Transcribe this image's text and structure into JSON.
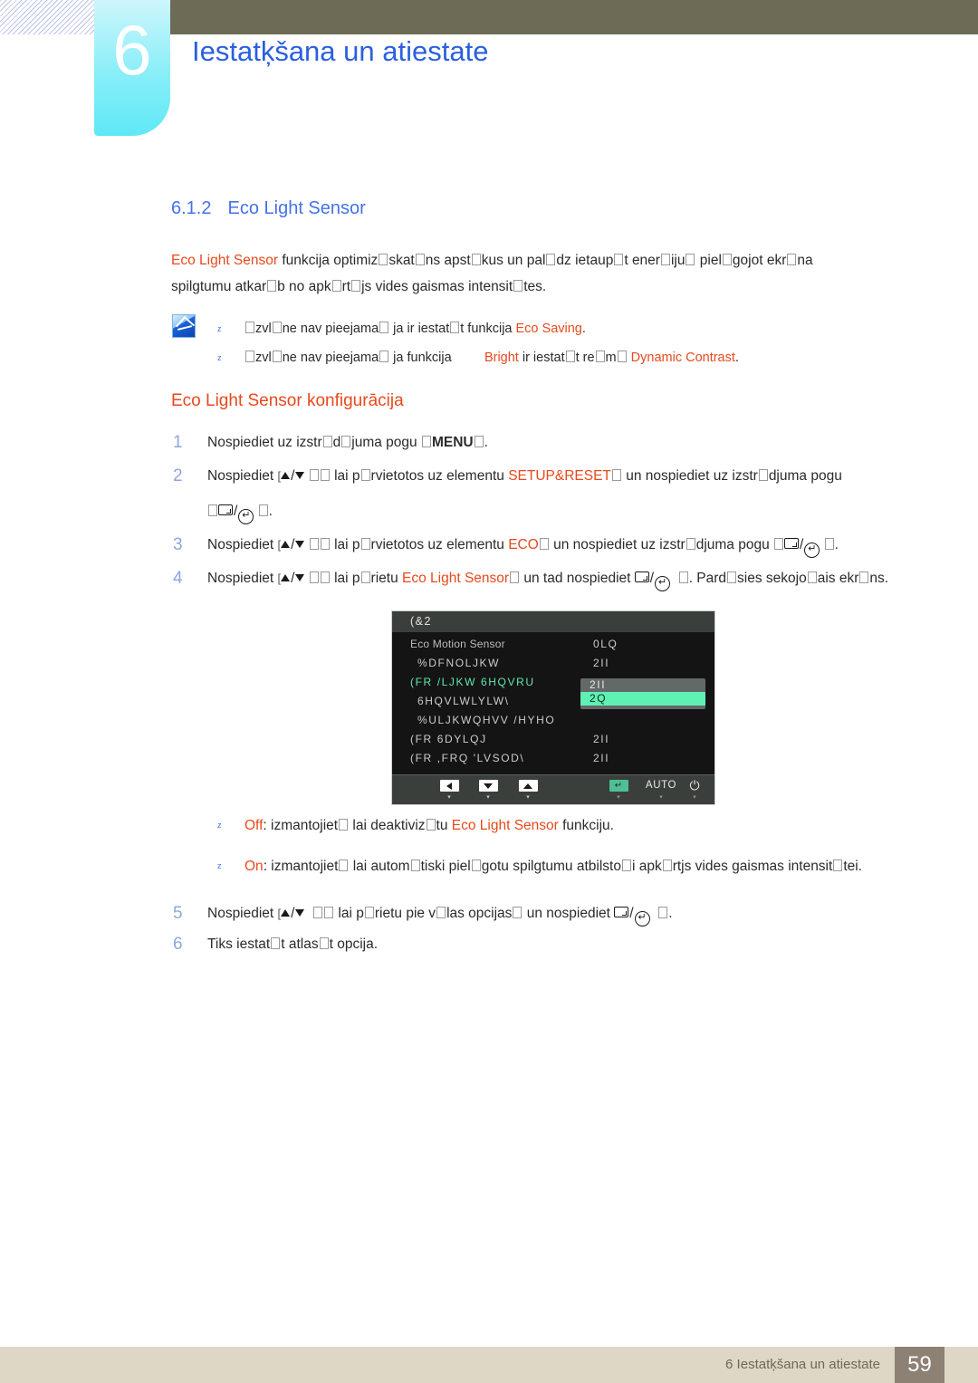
{
  "header": {
    "chapter_number": "6",
    "chapter_title": "Iestatķšana un atiestate"
  },
  "section": {
    "number": "6.1.2",
    "title": "Eco Light Sensor"
  },
  "intro": {
    "term": "Eco Light Sensor",
    "text_part1": " funkcija optimiz",
    "text_part2": "skat",
    "text_part3": "ns apst",
    "text_part4": "k",
    "text_part5": "us un pal",
    "text_part6": "dz ietaup",
    "text_part7": "t ener",
    "text_part8": "iju",
    "text_part9": " piel",
    "text_part10": "gojot ekr",
    "text_part11": "na spilgtumu atkar",
    "text_part12": "b",
    "text_part13": " no apk",
    "text_part14": "rt",
    "text_part15": "js vides gaismas intensit",
    "text_part16": "tes.",
    "full": "Eco Light Sensor funkcija optimiz skatans apstkus un paldz ietaupt eneriju, pielgojot ekrna spilgtumu atkarb no apkrtjs vides gaismas intensittes."
  },
  "note": {
    "icon": "note-pencil-icon",
    "bullets": [
      {
        "marker": "z",
        "pre": "zvl",
        "pre2": "ne nav pieejama",
        "mid": " ja ir iestat",
        "mid2": "t",
        "mid3": " funkcija ",
        "term": "Eco Saving",
        "post": "."
      },
      {
        "marker": "z",
        "pre": "zvl",
        "pre2": "ne nav pieejama",
        "mid": " ja funkcija ",
        "term1": "Bright",
        "mid2": " ir iestat",
        "mid3": "t",
        "mid4": " re",
        "mid5": "m",
        "term2": "Dynamic Contrast",
        "post": "."
      }
    ]
  },
  "subheading": "Eco Light Sensor konfigurācija",
  "steps": [
    {
      "index": "1",
      "pre": "Nospiediet uz izstr",
      "pre2": "d",
      "pre3": "juma pogu ",
      "bold": "MENU",
      "post": "."
    },
    {
      "index": "2",
      "pre": "Nospiediet ",
      "keys1": "up-down-arrows",
      "mid": " lai p",
      "mid2": "rvietotos uz elementu ",
      "term": "SETUP&RESET",
      "mid3": " un nospiediet uz izstr",
      "mid4": "djuma pogu ",
      "keys2": "square-slash-enter",
      "post": "."
    },
    {
      "index": "3",
      "pre": "Nospiediet ",
      "keys1": "up-down-arrows",
      "mid": " lai p",
      "mid2": "rvietotos uz elementu ",
      "term": "ECO",
      "mid3": " un nospiediet uz izstr",
      "mid4": "djuma pogu ",
      "keys2": "square-slash-enter",
      "post": "."
    },
    {
      "index": "4",
      "pre": "Nospiediet ",
      "keys1": "up-down-arrows",
      "mid": " lai p",
      "mid2": "rietu ",
      "term": "Eco Light Sensor",
      "mid3": " un tad nospiediet ",
      "keys2": "square-slash-enter",
      "post": ". Pard",
      "post2": "sies sekojo",
      "post3": "ais ekr",
      "post4": "ns."
    },
    {
      "index": "5",
      "pre": "Nospiediet ",
      "keys1": "up-down-arrows",
      "mid": " lai p",
      "mid2": "rietu pie v",
      "mid3": "las opcijas",
      "mid4": " un nospiediet ",
      "keys2": "square-slash-enter",
      "post": "."
    },
    {
      "index": "6",
      "pre": "Tiks iestat",
      "pre2": "t",
      "pre3": " atlas",
      "pre4": "t",
      "pre5": " opcija."
    }
  ],
  "osd": {
    "title": "(&2",
    "rows": [
      {
        "label": "Eco Motion Sensor",
        "value": "0LQ",
        "plain": true,
        "selected": false,
        "indent": false
      },
      {
        "label": "%DFNOLJKW",
        "value": "2II",
        "plain": false,
        "selected": false,
        "indent": true
      },
      {
        "label": "(FR /LJKW 6HQVRU",
        "value": "",
        "plain": false,
        "selected": true,
        "indent": false
      },
      {
        "label": "6HQVLWLYLW\\",
        "value": "",
        "plain": false,
        "selected": false,
        "indent": true
      },
      {
        "label": "%ULJKWQHVV /HYHO",
        "value": "",
        "plain": false,
        "selected": false,
        "indent": true
      },
      {
        "label": "(FR 6DYLQJ",
        "value": "2II",
        "plain": false,
        "selected": false,
        "indent": false
      },
      {
        "label": "(FR ,FRQ 'LVSOD\\",
        "value": "2II",
        "plain": false,
        "selected": false,
        "indent": false
      }
    ],
    "dropdown": {
      "items": [
        {
          "label": "2II",
          "highlighted": false
        },
        {
          "label": "2Q",
          "highlighted": true
        }
      ]
    },
    "buttons": [
      {
        "name": "left-arrow-button",
        "glyph": "left",
        "label": "",
        "sub": "▾"
      },
      {
        "name": "down-arrow-button",
        "glyph": "down",
        "label": "",
        "sub": "▾"
      },
      {
        "name": "up-arrow-button",
        "glyph": "up",
        "label": "",
        "sub": "▾"
      },
      {
        "name": "enter-button",
        "glyph": "enter",
        "label": "",
        "sub": "▾"
      },
      {
        "name": "auto-button",
        "glyph": "text",
        "label": "AUTO",
        "sub": "▾"
      },
      {
        "name": "power-button",
        "glyph": "power",
        "label": "⏻",
        "sub": "▾"
      }
    ],
    "colors": {
      "background": "#141414",
      "titlebar": "#3a3f3c",
      "highlight": "#5ff0b4",
      "selected_text": "#5fe8b0"
    }
  },
  "image_bullets": [
    {
      "marker": "z",
      "term1": "Off",
      "mid": ": izmantojiet",
      "mid2": " lai deaktiviz",
      "mid3": "tu ",
      "term2": "Eco Light Sensor",
      "post": " funkciju."
    },
    {
      "marker": "z",
      "term1": "On",
      "mid": ": izmantojiet",
      "mid2": " lai autom",
      "mid3": "tiski piel",
      "mid4": "gotu spilgtumu atbilsto",
      "mid5": "i apk",
      "mid6": "rtjs vides gaismas intensit",
      "mid7": "tei."
    }
  ],
  "footer": {
    "text": "6 Iestatķšana un atiestate",
    "page": "59"
  },
  "colors": {
    "accent_blue": "#2a5fe0",
    "heading_blue": "#4472e8",
    "accent_orange": "#e8491d",
    "chapter_tab": "#5fe8f6",
    "header_bar": "#6d6a55",
    "footer_bar": "#ded7c5",
    "footer_page": "#8d8174"
  }
}
